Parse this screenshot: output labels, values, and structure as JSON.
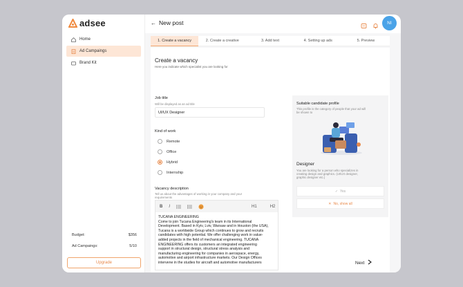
{
  "app": {
    "logo_text": "adsee"
  },
  "sidebar": {
    "items": [
      {
        "label": "Home",
        "icon": "home-icon"
      },
      {
        "label": "Ad Campaings",
        "icon": "clipboard-icon",
        "active": true
      },
      {
        "label": "Brand Kit",
        "icon": "folder-icon"
      }
    ],
    "budget_label": "Budget:",
    "budget_value": "$356",
    "campaigns_label": "Ad Campaings:",
    "campaigns_value": "5/10",
    "upgrade_label": "Upgrade"
  },
  "header": {
    "back_icon": "back-arrow-icon",
    "title": "New post",
    "avatar_initials": "NI"
  },
  "tabs": [
    {
      "label": "1. Create a vacancy",
      "active": true
    },
    {
      "label": "2. Create a creative"
    },
    {
      "label": "3. Add text"
    },
    {
      "label": "4. Setting up ads"
    },
    {
      "label": "5. Preview"
    }
  ],
  "form": {
    "heading": "Create a vacancy",
    "subheading": "Here you indicate which specialist you are looking for",
    "job_title_label": "Job title",
    "job_title_hint": "Will be displayed as an ad title",
    "job_title_value": "UI/UX Designer",
    "kind_label": "Kind of work",
    "kinds": [
      {
        "label": "Remote",
        "selected": false
      },
      {
        "label": "Office",
        "selected": false
      },
      {
        "label": "Hybrid",
        "selected": true
      },
      {
        "label": "Internship",
        "selected": false
      }
    ],
    "desc_label": "Vacancy description",
    "desc_hint_1": "Tell us about the advantages of working in your company and your",
    "desc_hint_2": "requirements",
    "toolbar": {
      "bold": "B",
      "italic": "I",
      "h1": "H1",
      "h2": "H2"
    },
    "desc_title": "TUCANA ENGINEERING",
    "desc_lines": [
      "Come to join Tucana Engineering's team in its International",
      "Development. Based in Kyiv, Lviv, Warsaw and in Houston (the USA),",
      "Tucana is a worldwide Group which continues to grow and recruits",
      "candidates with high potential. We offer challenging work in value-",
      "added projects in the field of mechanical engineering. TUCANA",
      "ENGINEERING offers its customers an integrated engineering",
      "support in structural design, structural stress analysis and",
      "manufacturing engineering for companies in aerospace, energy,",
      "automotive and airport infrastructure markets. Our Design Offices",
      "intervene in the studies for aircraft and automotive manufacturers"
    ]
  },
  "panel": {
    "title": "Suitable candidate profile",
    "hint_1": "This profile is the category of people that your ad will",
    "hint_2": "be shown to",
    "profile_name": "Designer",
    "profile_desc_1": "You are looking for a person who specializes in",
    "profile_desc_2": "creating design and graphics. (UI/UX designer,",
    "profile_desc_3": "graphic designer etc.)",
    "yes_label": "Yes",
    "no_label": "No, show all"
  },
  "footer": {
    "next_label": "Next"
  },
  "colors": {
    "accent": "#e8894a",
    "active_bg": "#fde6d6",
    "avatar": "#4aa3e8"
  }
}
